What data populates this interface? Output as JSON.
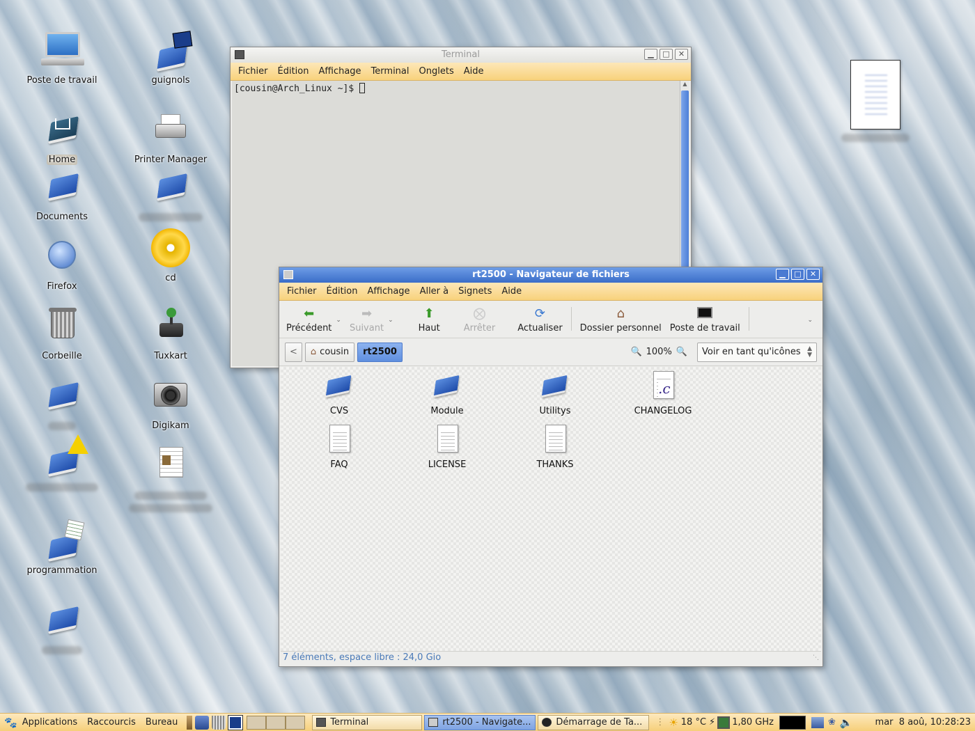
{
  "desktop": {
    "icons": [
      {
        "name": "poste-de-travail",
        "label": "Poste de travail"
      },
      {
        "name": "guignols",
        "label": "guignols"
      },
      {
        "name": "home",
        "label": "Home"
      },
      {
        "name": "printer-manager",
        "label": "Printer Manager"
      },
      {
        "name": "documents",
        "label": "Documents"
      },
      {
        "name": "firefox",
        "label": "Firefox"
      },
      {
        "name": "cd",
        "label": "cd"
      },
      {
        "name": "corbeille",
        "label": "Corbeille"
      },
      {
        "name": "tuxkart",
        "label": "Tuxkart"
      },
      {
        "name": "digikam",
        "label": "Digikam"
      },
      {
        "name": "programmation",
        "label": "programmation"
      }
    ]
  },
  "terminal": {
    "title": "Terminal",
    "menu": [
      "Fichier",
      "Édition",
      "Affichage",
      "Terminal",
      "Onglets",
      "Aide"
    ],
    "prompt": "[cousin@Arch_Linux ~]$ "
  },
  "filemanager": {
    "title": "rt2500 - Navigateur de fichiers",
    "menu": [
      "Fichier",
      "Édition",
      "Affichage",
      "Aller à",
      "Signets",
      "Aide"
    ],
    "toolbar": {
      "back": "Précédent",
      "forward": "Suivant",
      "up": "Haut",
      "stop": "Arrêter",
      "reload": "Actualiser",
      "home": "Dossier personnel",
      "computer": "Poste de travail"
    },
    "path": {
      "back_glyph": "<",
      "parent": "cousin",
      "current": "rt2500"
    },
    "zoom": "100%",
    "view_mode": "Voir en tant qu'icônes",
    "files": [
      {
        "label": "CVS",
        "type": "folder"
      },
      {
        "label": "Module",
        "type": "folder"
      },
      {
        "label": "Utilitys",
        "type": "folder"
      },
      {
        "label": "CHANGELOG",
        "type": "c-source"
      },
      {
        "label": "FAQ",
        "type": "text"
      },
      {
        "label": "LICENSE",
        "type": "text"
      },
      {
        "label": "THANKS",
        "type": "text"
      }
    ],
    "status": "7 éléments, espace libre : 24,0 Gio"
  },
  "panel": {
    "menus": [
      "Applications",
      "Raccourcis",
      "Bureau"
    ],
    "tasks": [
      "Terminal",
      "rt2500 - Navigate...",
      "Démarrage de Ta..."
    ],
    "weather": "18 °C",
    "cpu_freq": "1,80 GHz",
    "clock": "mar  8 aoû, 10:28:23"
  }
}
